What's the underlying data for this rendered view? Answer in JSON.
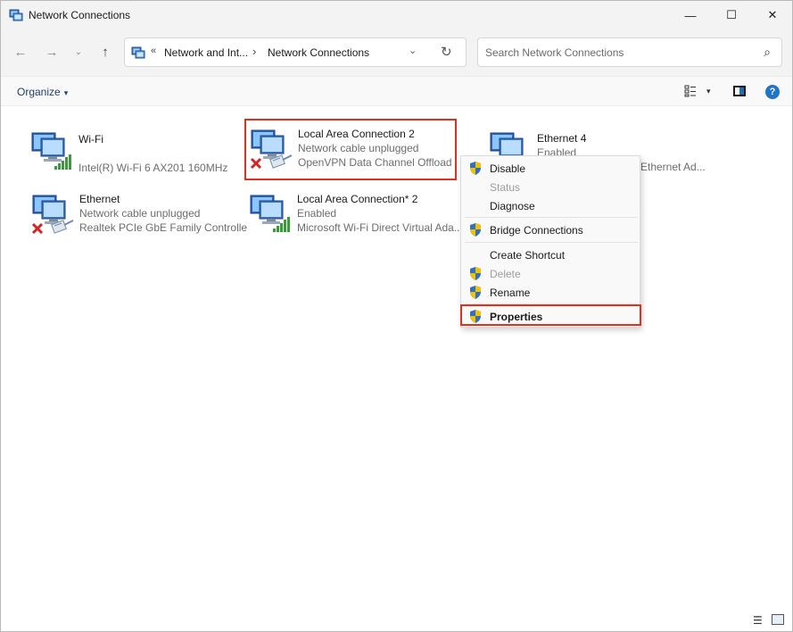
{
  "window": {
    "title": "Network Connections"
  },
  "titlebar_buttons": {
    "minimize": "—",
    "maximize": "☐",
    "close": "✕"
  },
  "nav": {
    "back": "←",
    "forward": "→",
    "recent": "⌄",
    "up": "↑"
  },
  "address": {
    "chevron": "«",
    "segment1": "Network and Int...",
    "separator": "›",
    "segment2": "Network Connections",
    "dropdown": "⌄",
    "refresh": "↻"
  },
  "search": {
    "placeholder": "Search Network Connections"
  },
  "commandbar": {
    "organize_label": "Organize",
    "organize_caret": "▾",
    "view_caret": "▾",
    "help": "?"
  },
  "connections": [
    {
      "name": "Wi-Fi",
      "status": "",
      "device": "Intel(R) Wi-Fi 6 AX201 160MHz",
      "badge": "signal"
    },
    {
      "name": "Local Area Connection 2",
      "status": "Network cable unplugged",
      "device": "OpenVPN Data Channel Offload",
      "badge": "cable-x"
    },
    {
      "name": "Ethernet 4",
      "status": "Enabled",
      "device": "Ethernet Ad...",
      "badge": "none"
    },
    {
      "name": "Ethernet",
      "status": "Network cable unplugged",
      "device": "Realtek PCIe GbE Family Controlle",
      "badge": "cable-x"
    },
    {
      "name": "Local Area Connection* 2",
      "status": "Enabled",
      "device": "Microsoft Wi-Fi Direct Virtual Ada...",
      "badge": "signal"
    }
  ],
  "context_menu": {
    "items": [
      {
        "label": "Disable",
        "shield": true,
        "disabled": false,
        "bold": false
      },
      {
        "label": "Status",
        "shield": false,
        "disabled": true,
        "bold": false
      },
      {
        "label": "Diagnose",
        "shield": false,
        "disabled": false,
        "bold": false
      },
      {
        "label": "Bridge Connections",
        "shield": true,
        "disabled": false,
        "bold": false
      },
      {
        "label": "Create Shortcut",
        "shield": false,
        "disabled": false,
        "bold": false
      },
      {
        "label": "Delete",
        "shield": true,
        "disabled": true,
        "bold": false
      },
      {
        "label": "Rename",
        "shield": true,
        "disabled": false,
        "bold": false
      },
      {
        "label": "Properties",
        "shield": true,
        "disabled": false,
        "bold": true
      }
    ]
  },
  "statusbar": {
    "details_view": "☰"
  },
  "colors": {
    "highlight": "#e0301e",
    "titlebar_bg": "#f3f3f3",
    "signal_green": "#3c9a3c",
    "error_red": "#d42424",
    "shield_blue": "#2f6fc4",
    "shield_yellow": "#f2c200"
  }
}
